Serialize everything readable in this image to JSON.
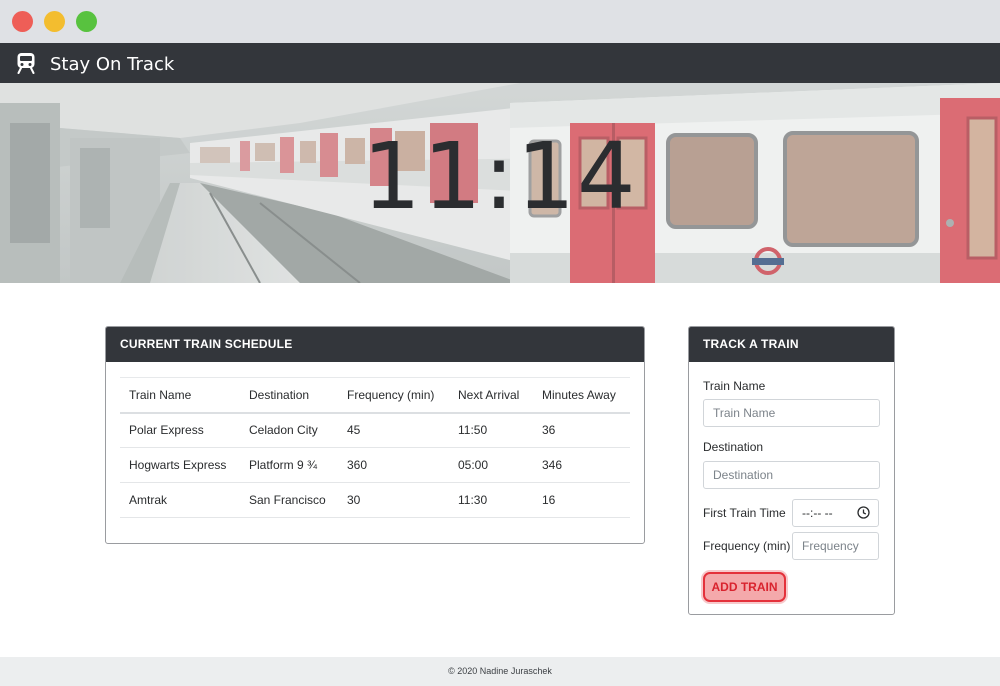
{
  "app": {
    "title": "Stay On Track",
    "icon": "train-icon"
  },
  "hero": {
    "current_time": "11:14"
  },
  "schedule": {
    "title": "CURRENT TRAIN SCHEDULE",
    "columns": [
      "Train Name",
      "Destination",
      "Frequency (min)",
      "Next Arrival",
      "Minutes Away"
    ],
    "rows": [
      [
        "Polar Express",
        "Celadon City",
        "45",
        "11:50",
        "36"
      ],
      [
        "Hogwarts Express",
        "Platform 9 ¾",
        "360",
        "05:00",
        "346"
      ],
      [
        "Amtrak",
        "San Francisco",
        "30",
        "11:30",
        "16"
      ]
    ]
  },
  "track_form": {
    "title": "TRACK A TRAIN",
    "train_name_label": "Train Name",
    "train_name_placeholder": "Train Name",
    "destination_label": "Destination",
    "destination_placeholder": "Destination",
    "first_train_time_label": "First Train Time",
    "first_train_time_value": "--:-- --",
    "frequency_label": "Frequency (min)",
    "frequency_placeholder": "Frequency",
    "submit_label": "ADD TRAIN"
  },
  "footer": {
    "text": "© 2020 Nadine Juraschek"
  },
  "colors": {
    "navbar": "#33363b",
    "accent_red": "#e4313b",
    "button_fill": "#f4a9ab"
  }
}
